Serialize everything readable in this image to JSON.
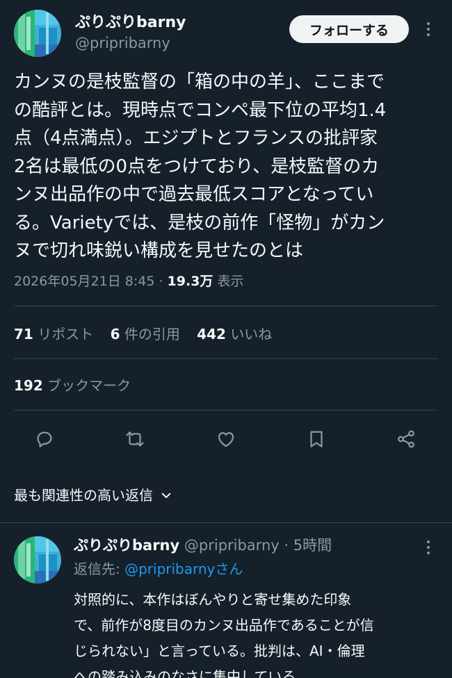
{
  "tweet": {
    "author": {
      "display_name": "ぷりぷりbarny",
      "handle": "@pripribarny"
    },
    "follow_label": "フォローする",
    "text": "カンヌの是枝監督の「箱の中の羊」、ここまでの酷評とは。現時点でコンペ最下位の平均1.4点（4点満点）。エジプトとフランスの批評家2名は最低の0点をつけており、是枝監督のカンヌ出品作の中で過去最低スコアとなっている。Varietyでは、是枝の前作「怪物」がカンヌで切れ味鋭い構成を見せたのとは",
    "text_lines": [
      "カンヌの是枝監督の「箱の中の羊」、ここまで",
      "の酷評とは。現時点でコンペ最下位の平均1.4",
      "点（4点満点）。エジプトとフランスの批評家",
      "2名は最低の0点をつけており、是枝監督のカ",
      "ンヌ出品作の中で過去最低スコアとなってい",
      "る。Varietyでは、是枝の前作「怪物」がカン",
      "ヌで切れ味鋭い構成を見せたのとは"
    ],
    "timestamp": "2026年05月21日 8:45 · ",
    "views_count": "19.3万",
    "views_label": " 表示"
  },
  "stats": {
    "reposts": {
      "count": "71",
      "label": "リポスト"
    },
    "quotes": {
      "count": "6",
      "label": "件の引用"
    },
    "likes": {
      "count": "442",
      "label": "いいね"
    },
    "bookmarks": {
      "count": "192",
      "label": "ブックマーク"
    }
  },
  "actions": {
    "icons": [
      "reply-icon",
      "repost-icon",
      "like-icon",
      "bookmark-icon",
      "share-icon"
    ]
  },
  "replies_sort": {
    "label": "最も関連性の高い返信"
  },
  "reply": {
    "display_name": "ぷりぷりbarny",
    "handle_time": "@pripribarny · 5時間",
    "reply_to_prefix": "返信先: ",
    "reply_to_handle": "@pripribarnyさん",
    "text_lines": [
      "対照的に、本作はぼんやりと寄せ集めた印象",
      "で、前作が8度目のカンヌ出品作であることが信",
      "じられない」と言っている。批判は、AI・倫理",
      "への踏み込みのなさに集中している。"
    ]
  },
  "colors": {
    "background": "#15202b",
    "text_primary": "#f7f9f9",
    "text_secondary": "#8b98a5",
    "accent": "#1d9bf0",
    "divider": "#38444d"
  }
}
